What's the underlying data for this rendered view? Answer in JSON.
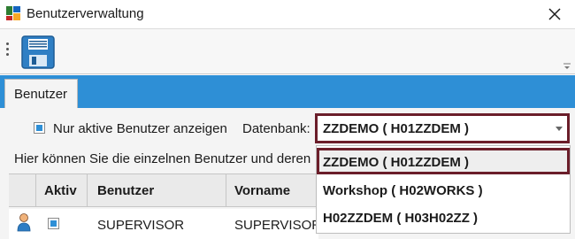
{
  "window": {
    "title": "Benutzerverwaltung",
    "app_icon": "app-icon",
    "close_icon": "close-icon"
  },
  "toolbar": {
    "save_icon": "floppy-disk-icon"
  },
  "tabs": [
    {
      "label": "Benutzer"
    }
  ],
  "filter": {
    "only_active_label": "Nur aktive Benutzer anzeigen",
    "only_active_checked": true,
    "database_label": "Datenbank:"
  },
  "database_combo": {
    "value": "ZZDEMO  ( H01ZZDEM )",
    "expanded": true,
    "options": [
      {
        "label": "ZZDEMO  ( H01ZZDEM )",
        "selected": true
      },
      {
        "label": "Workshop  ( H02WORKS )",
        "selected": false
      },
      {
        "label": "H02ZZDEM  ( H03H02ZZ )",
        "selected": false
      }
    ]
  },
  "hint_text": "Hier können Sie die einzelnen Benutzer und deren",
  "grid": {
    "columns": [
      "Aktiv",
      "Benutzer",
      "Vorname"
    ],
    "rows": [
      {
        "aktiv": true,
        "benutzer": "SUPERVISOR",
        "vorname": "SUPERVISOR"
      }
    ]
  },
  "colors": {
    "accent": "#2e8fd6",
    "highlight_border": "#6b1e2a"
  }
}
